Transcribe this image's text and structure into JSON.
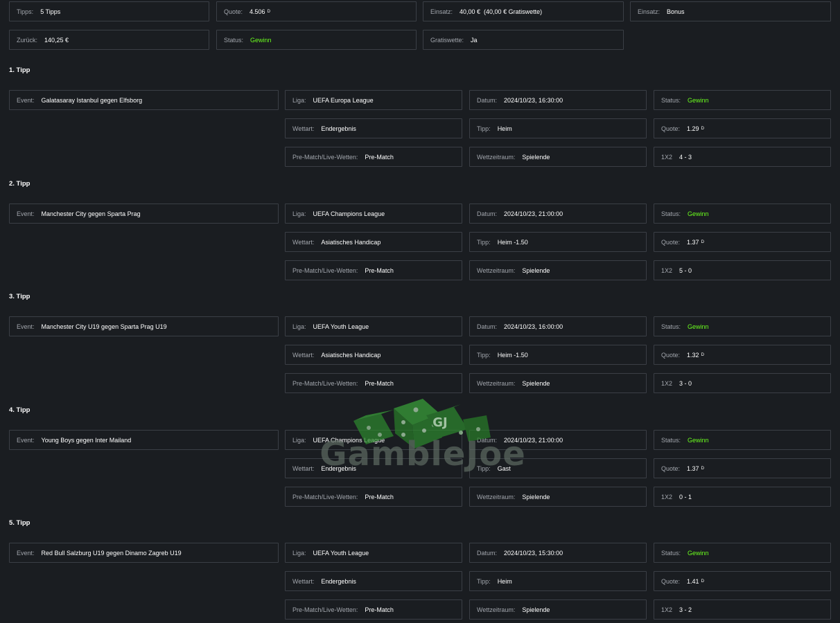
{
  "summary": {
    "tipps": {
      "label": "Tipps:",
      "value": "5 Tipps"
    },
    "quote": {
      "label": "Quote:",
      "value": "4.506",
      "sup": "D"
    },
    "einsatz": {
      "label": "Einsatz:",
      "value": "40,00 €",
      "extra": "(40,00 € Gratiswette)"
    },
    "einsatz_type": {
      "label": "Einsatz:",
      "value": "Bonus"
    },
    "zurueck": {
      "label": "Zurück:",
      "value": "140,25 €"
    },
    "status": {
      "label": "Status:",
      "value": "Gewinn"
    },
    "gratiswette": {
      "label": "Gratiswette:",
      "value": "Ja"
    }
  },
  "labels": {
    "event": "Event:",
    "liga": "Liga:",
    "datum": "Datum:",
    "status": "Status:",
    "wettart": "Wettart:",
    "tipp": "Tipp:",
    "quote": "Quote:",
    "prematch": "Pre-Match/Live-Wetten:",
    "wettzeitraum": "Wettzeitraum:",
    "x12": "1X2"
  },
  "tips": [
    {
      "title": "1. Tipp",
      "event": "Galatasaray Istanbul gegen Elfsborg",
      "liga": "UEFA Europa League",
      "datum": "2024/10/23, 16:30:00",
      "status": "Gewinn",
      "wettart": "Endergebnis",
      "tipp": "Heim",
      "quote": "1.29",
      "quote_sup": "D",
      "prematch": "Pre-Match",
      "wettzeitraum": "Spielende",
      "result": "4 - 3"
    },
    {
      "title": "2. Tipp",
      "event": "Manchester City gegen Sparta Prag",
      "liga": "UEFA Champions League",
      "datum": "2024/10/23, 21:00:00",
      "status": "Gewinn",
      "wettart": "Asiatisches Handicap",
      "tipp": "Heim -1.50",
      "quote": "1.37",
      "quote_sup": "D",
      "prematch": "Pre-Match",
      "wettzeitraum": "Spielende",
      "result": "5 - 0"
    },
    {
      "title": "3. Tipp",
      "event": "Manchester City U19 gegen Sparta Prag U19",
      "liga": "UEFA Youth League",
      "datum": "2024/10/23, 16:00:00",
      "status": "Gewinn",
      "wettart": "Asiatisches Handicap",
      "tipp": "Heim -1.50",
      "quote": "1.32",
      "quote_sup": "D",
      "prematch": "Pre-Match",
      "wettzeitraum": "Spielende",
      "result": "3 - 0"
    },
    {
      "title": "4. Tipp",
      "event": "Young Boys gegen Inter Mailand",
      "liga": "UEFA Champions League",
      "datum": "2024/10/23, 21:00:00",
      "status": "Gewinn",
      "wettart": "Endergebnis",
      "tipp": "Gast",
      "quote": "1.37",
      "quote_sup": "D",
      "prematch": "Pre-Match",
      "wettzeitraum": "Spielende",
      "result": "0 - 1"
    },
    {
      "title": "5. Tipp",
      "event": "Red Bull Salzburg U19 gegen Dinamo Zagreb U19",
      "liga": "UEFA Youth League",
      "datum": "2024/10/23, 15:30:00",
      "status": "Gewinn",
      "wettart": "Endergebnis",
      "tipp": "Heim",
      "quote": "1.41",
      "quote_sup": "D",
      "prematch": "Pre-Match",
      "wettzeitraum": "Spielende",
      "result": "3 - 2"
    }
  ],
  "watermark": {
    "text": "GambleJoe",
    "dice_badge": "GJ"
  },
  "colors": {
    "status_win": "#6bff1e",
    "watermark_dice": "#2e8b2e"
  }
}
